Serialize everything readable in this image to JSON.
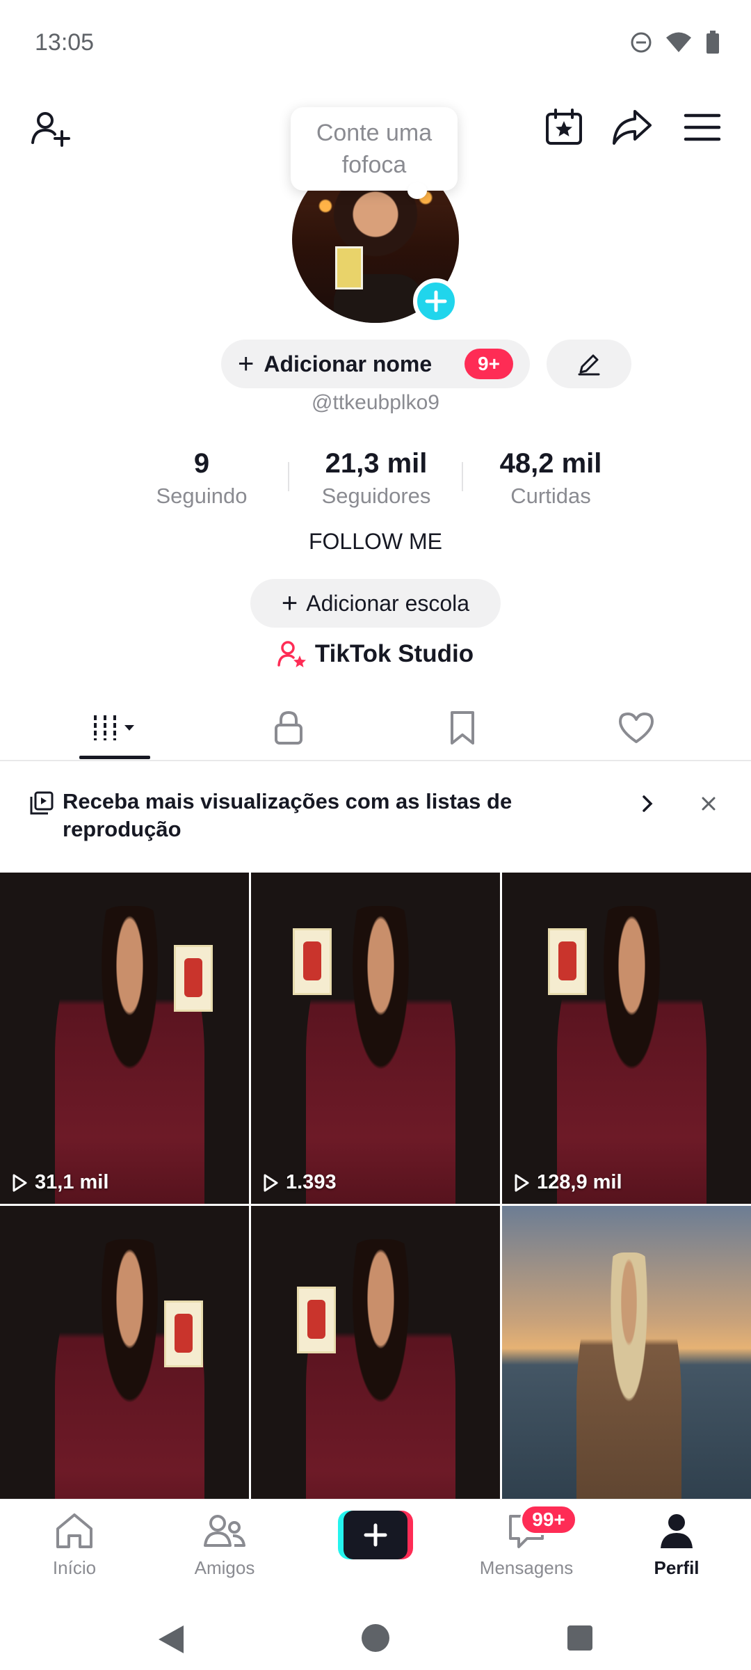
{
  "status_bar": {
    "time": "13:05"
  },
  "tooltip": {
    "line1": "Conte uma",
    "line2": "fofoca"
  },
  "profile": {
    "add_name_label": "Adicionar nome",
    "name_badge": "9+",
    "handle": "@ttkeubplko9",
    "bio": "FOLLOW ME",
    "add_school_label": "Adicionar escola",
    "studio_label": "TikTok Studio"
  },
  "stats": [
    {
      "value": "9",
      "label": "Seguindo"
    },
    {
      "value": "21,3 mil",
      "label": "Seguidores"
    },
    {
      "value": "48,2 mil",
      "label": "Curtidas"
    }
  ],
  "banner": {
    "text": "Receba mais visualizações com as listas de reprodução"
  },
  "videos": [
    {
      "views": "31,1 mil"
    },
    {
      "views": "1.393"
    },
    {
      "views": "128,9 mil"
    },
    {
      "views": ""
    },
    {
      "views": ""
    },
    {
      "views": ""
    }
  ],
  "bottom_nav": {
    "home": "Início",
    "friends": "Amigos",
    "messages": "Mensagens",
    "messages_badge": "99+",
    "profile": "Perfil"
  },
  "colors": {
    "accent": "#fe2c55",
    "cyan": "#20d5ec",
    "text": "#161823",
    "muted": "#8a8b91"
  }
}
